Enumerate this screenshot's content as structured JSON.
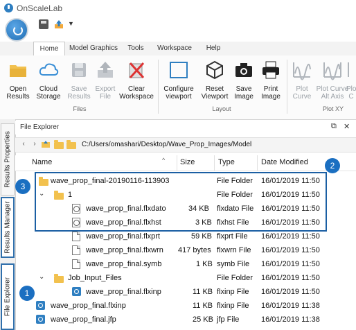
{
  "app": {
    "title": "OnScaleLab"
  },
  "tabs": [
    "Home",
    "Model Graphics",
    "Tools",
    "Workspace",
    "Help"
  ],
  "ribbon": {
    "files": {
      "open": "Open\nResults",
      "cloud": "Cloud\nStorage",
      "save_results": "Save\nResults",
      "export_file": "Export\nFile",
      "clear_ws": "Clear\nWorkspace",
      "label": "Files"
    },
    "layout": {
      "configure": "Configure\nviewport",
      "reset": "Reset\nViewport",
      "save_image": "Save\nImage",
      "print_image": "Print\nImage",
      "label": "Layout"
    },
    "plot": {
      "plot_curve": "Plot\nCurve",
      "plot_alt": "Plot Curve\nAlt Axis",
      "plot_c": "Plo\nC",
      "label": "Plot XY"
    }
  },
  "sidetabs": {
    "results_properties": "Results Properties",
    "results_manager": "Results Manager",
    "file_explorer": "File Explorer"
  },
  "explorer": {
    "title": "File Explorer",
    "path": "C:/Users/omashari/Desktop/Wave_Prop_Images/Model",
    "columns": {
      "name": "Name",
      "size": "Size",
      "type": "Type",
      "date": "Date Modified"
    },
    "rows": [
      {
        "name": "wave_prop_final-20190116-113903",
        "size": "",
        "type": "File Folder",
        "date": "16/01/2019 11:50"
      },
      {
        "name": "1",
        "size": "",
        "type": "File Folder",
        "date": "16/01/2019 11:50"
      },
      {
        "name": "wave_prop_final.flxdato",
        "size": "34 KB",
        "type": "flxdato File",
        "date": "16/01/2019 11:50"
      },
      {
        "name": "wave_prop_final.flxhst",
        "size": "3 KB",
        "type": "flxhst File",
        "date": "16/01/2019 11:50"
      },
      {
        "name": "wave_prop_final.flxprt",
        "size": "59 KB",
        "type": "flxprt File",
        "date": "16/01/2019 11:50"
      },
      {
        "name": "wave_prop_final.flxwrn",
        "size": "417 bytes",
        "type": "flxwrn File",
        "date": "16/01/2019 11:50"
      },
      {
        "name": "wave_prop_final.symb",
        "size": "1 KB",
        "type": "symb File",
        "date": "16/01/2019 11:50"
      },
      {
        "name": "Job_Input_Files",
        "size": "",
        "type": "File Folder",
        "date": "16/01/2019 11:50"
      },
      {
        "name": "wave_prop_final.flxinp",
        "size": "11 KB",
        "type": "flxinp File",
        "date": "16/01/2019 11:50"
      },
      {
        "name": "wave_prop_final.flxinp",
        "size": "11 KB",
        "type": "flxinp File",
        "date": "16/01/2019 11:38"
      },
      {
        "name": "wave_prop_final.jfp",
        "size": "25 KB",
        "type": "jfp File",
        "date": "16/01/2019 11:38"
      }
    ]
  },
  "callouts": [
    "1",
    "2",
    "3"
  ],
  "colors": {
    "accent": "#1b6fc1",
    "folder": "#f2c14e"
  }
}
